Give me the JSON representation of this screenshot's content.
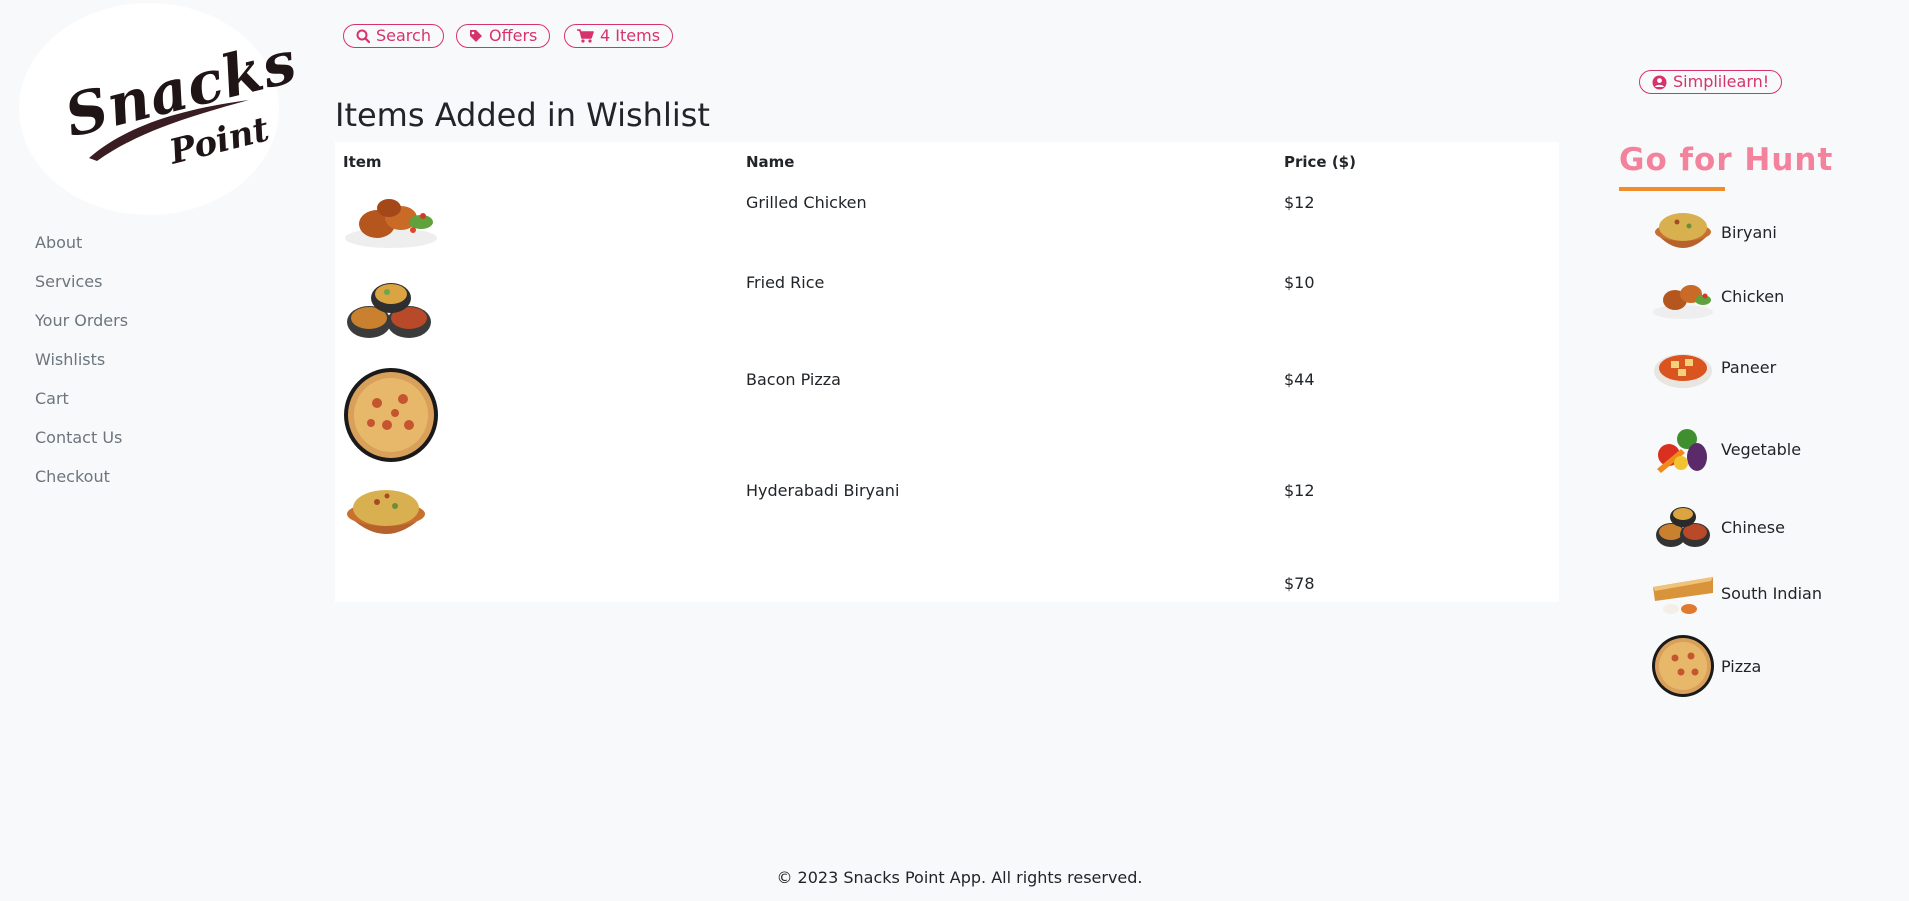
{
  "brand": {
    "logo_line1": "Snacks",
    "logo_line2": "Point"
  },
  "sidebar": {
    "items": [
      {
        "label": "About"
      },
      {
        "label": "Services"
      },
      {
        "label": "Your Orders"
      },
      {
        "label": "Wishlists"
      },
      {
        "label": "Cart"
      },
      {
        "label": "Contact Us"
      },
      {
        "label": "Checkout"
      }
    ]
  },
  "topbar": {
    "search_label": "Search",
    "offers_label": "Offers",
    "cart_label": "4 Items",
    "user_label": "Simplilearn!"
  },
  "main": {
    "title": "Items Added in Wishlist",
    "table": {
      "headers": {
        "item": "Item",
        "name": "Name",
        "price": "Price ($)"
      },
      "rows": [
        {
          "image": "grilled-chicken-image",
          "name": "Grilled Chicken",
          "price": "$12"
        },
        {
          "image": "fried-rice-image",
          "name": "Fried Rice",
          "price": "$10"
        },
        {
          "image": "bacon-pizza-image",
          "name": "Bacon Pizza",
          "price": "$44"
        },
        {
          "image": "hyderabadi-biryani-image",
          "name": "Hyderabadi Biryani",
          "price": "$12"
        }
      ],
      "total": "$78"
    }
  },
  "hunt": {
    "title": "Go for Hunt",
    "categories": [
      {
        "label": "Biryani",
        "icon": "biryani-image"
      },
      {
        "label": "Chicken",
        "icon": "chicken-image"
      },
      {
        "label": "Paneer",
        "icon": "paneer-image"
      },
      {
        "label": "Vegetable",
        "icon": "vegetable-image"
      },
      {
        "label": "Chinese",
        "icon": "chinese-image"
      },
      {
        "label": "South Indian",
        "icon": "south-indian-image"
      },
      {
        "label": "Pizza",
        "icon": "pizza-image"
      }
    ]
  },
  "footer": {
    "text": "© 2023 Snacks Point App. All rights reserved."
  },
  "colors": {
    "accent": "#d6336c",
    "hunt_title": "#f3829c",
    "underline": "#f28c28",
    "background": "#f8f9fa"
  }
}
